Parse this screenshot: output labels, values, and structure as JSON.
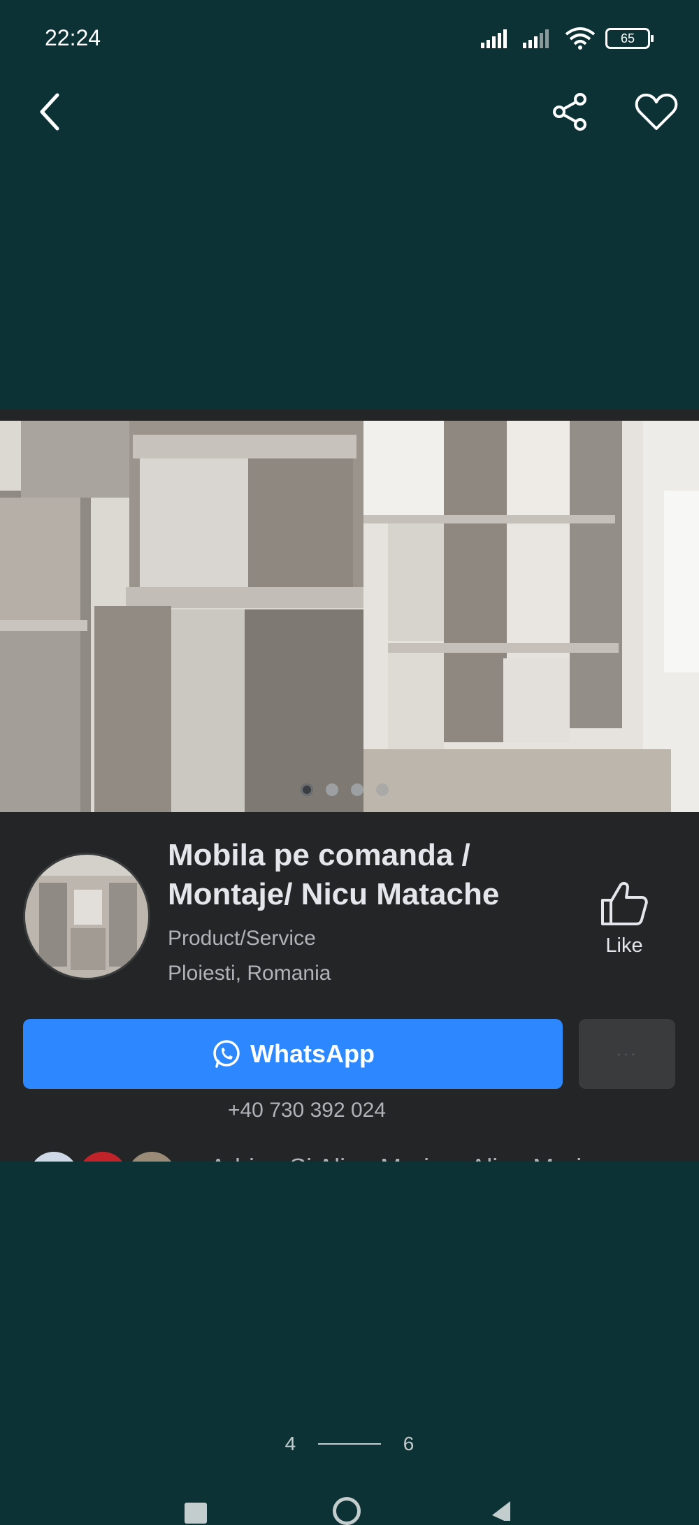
{
  "status_bar": {
    "time": "22:24",
    "battery": "65",
    "icons": [
      "signal-icon",
      "signal-icon",
      "wifi-icon",
      "battery-icon"
    ]
  },
  "toolbar": {
    "back_icon": "chevron-left-icon",
    "share_icon": "share-icon",
    "favorite_icon": "heart-icon"
  },
  "post": {
    "page_name": "Mobila pe comanda / Montaje/ Nicu Matache",
    "category": "Product/Service",
    "location": "Ploiesti, Romania",
    "like_label": "Like",
    "whatsapp_label": "WhatsApp",
    "more_label": "···",
    "phone": "+40 730 392 024",
    "friends_text": "Adrian Si Alina Marian, Alina Mari",
    "carousel": {
      "total": 4,
      "active": 1
    }
  },
  "pager": {
    "current": "4",
    "total": "6",
    "progress": 0.67
  },
  "colors": {
    "background": "#0c3236",
    "card": "#242526",
    "primary_button": "#2d88ff",
    "secondary_button": "#3a3b3c"
  }
}
